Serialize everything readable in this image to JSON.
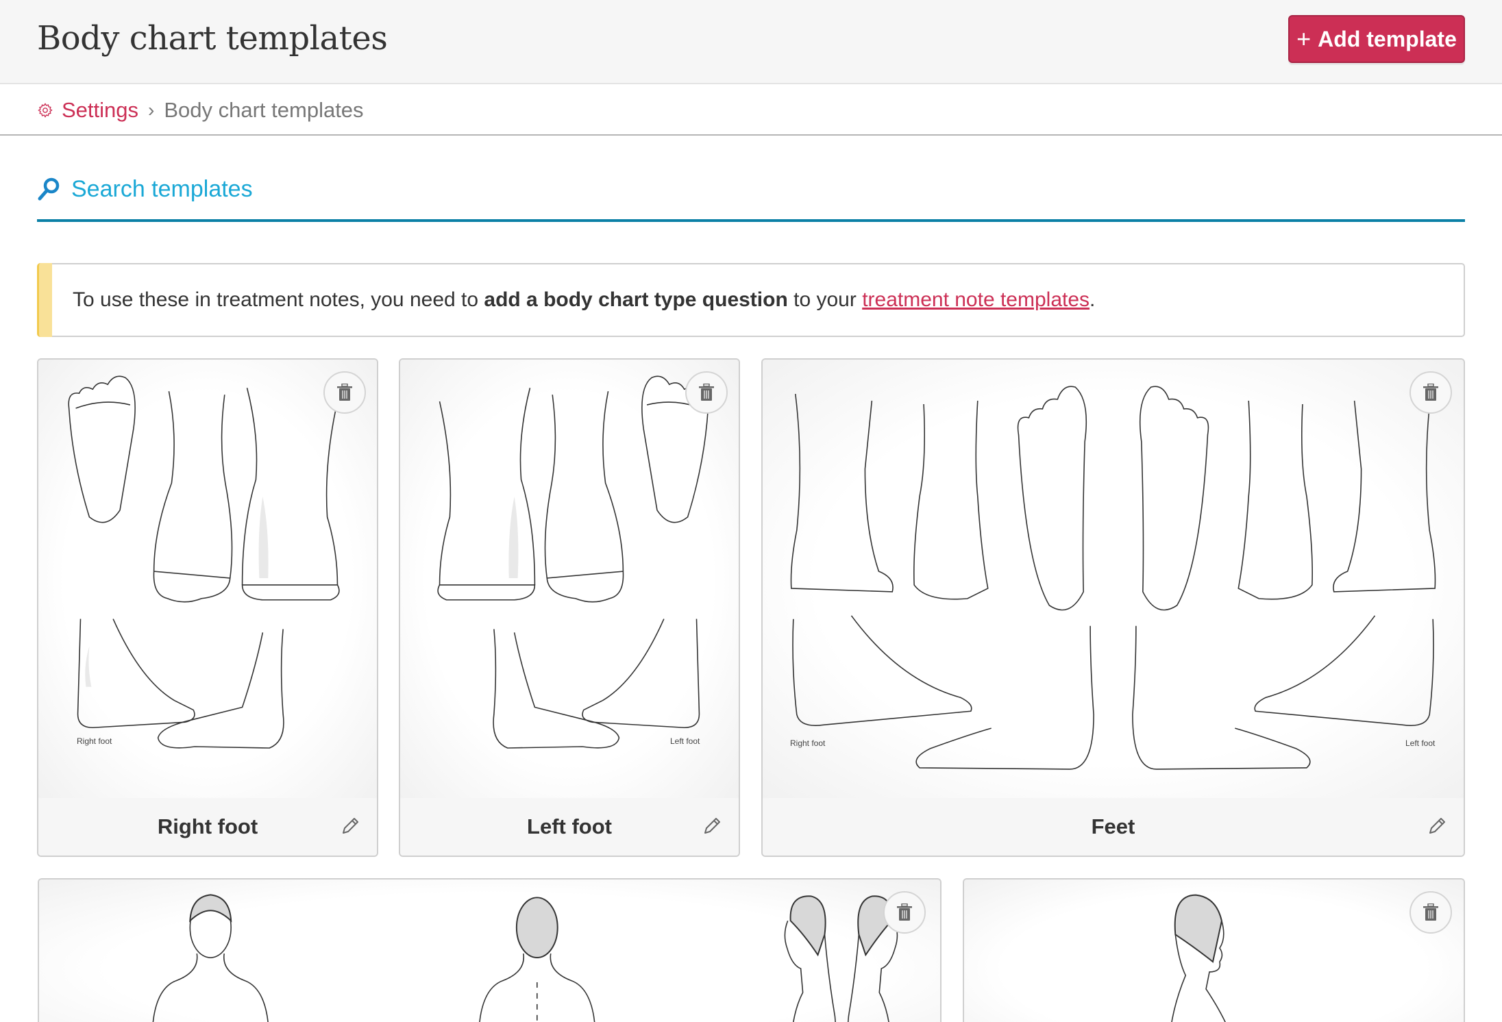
{
  "header": {
    "title": "Body chart templates",
    "add_button_label": "Add template",
    "add_button_icon": "plus-icon"
  },
  "breadcrumb": {
    "icon": "gear-icon",
    "parent_label": "Settings",
    "separator": "›",
    "current_label": "Body chart templates"
  },
  "search": {
    "icon": "search-icon",
    "placeholder": "Search templates",
    "value": ""
  },
  "alert": {
    "text_before": "To use these in treatment notes, you need to ",
    "bold_text": "add a body chart type question",
    "text_middle": " to your ",
    "link_text": "treatment note templates",
    "text_after": "."
  },
  "templates": [
    {
      "name": "Right foot",
      "captions": [
        "Right foot"
      ],
      "delete_icon": "trash-icon",
      "edit_icon": "pencil-icon"
    },
    {
      "name": "Left foot",
      "captions": [
        "Left foot"
      ],
      "delete_icon": "trash-icon",
      "edit_icon": "pencil-icon"
    },
    {
      "name": "Feet",
      "captions": [
        "Right foot",
        "Left foot"
      ],
      "delete_icon": "trash-icon",
      "edit_icon": "pencil-icon"
    },
    {
      "name": "",
      "captions": [],
      "delete_icon": "trash-icon"
    },
    {
      "name": "",
      "captions": [],
      "delete_icon": "trash-icon"
    }
  ],
  "colors": {
    "brand": "#cc2f55",
    "search_accent": "#1aa8d6",
    "search_underline": "#0b80a6",
    "alert_stripe": "#f9e198"
  }
}
